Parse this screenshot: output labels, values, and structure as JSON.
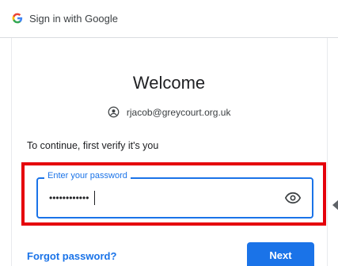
{
  "header": {
    "title": "Sign in with Google",
    "logo_icon": "google-g-icon"
  },
  "main": {
    "welcome": "Welcome",
    "account_icon": "account-circle-icon",
    "account_email": "rjacob@greycourt.org.uk",
    "continue_text": "To continue, first verify it's you"
  },
  "password": {
    "label": "Enter your password",
    "value": "••••••••••••",
    "show_icon": "eye-icon"
  },
  "actions": {
    "forgot": "Forgot password?",
    "next": "Next"
  },
  "colors": {
    "accent": "#1a73e8",
    "highlight": "#e5000b"
  }
}
